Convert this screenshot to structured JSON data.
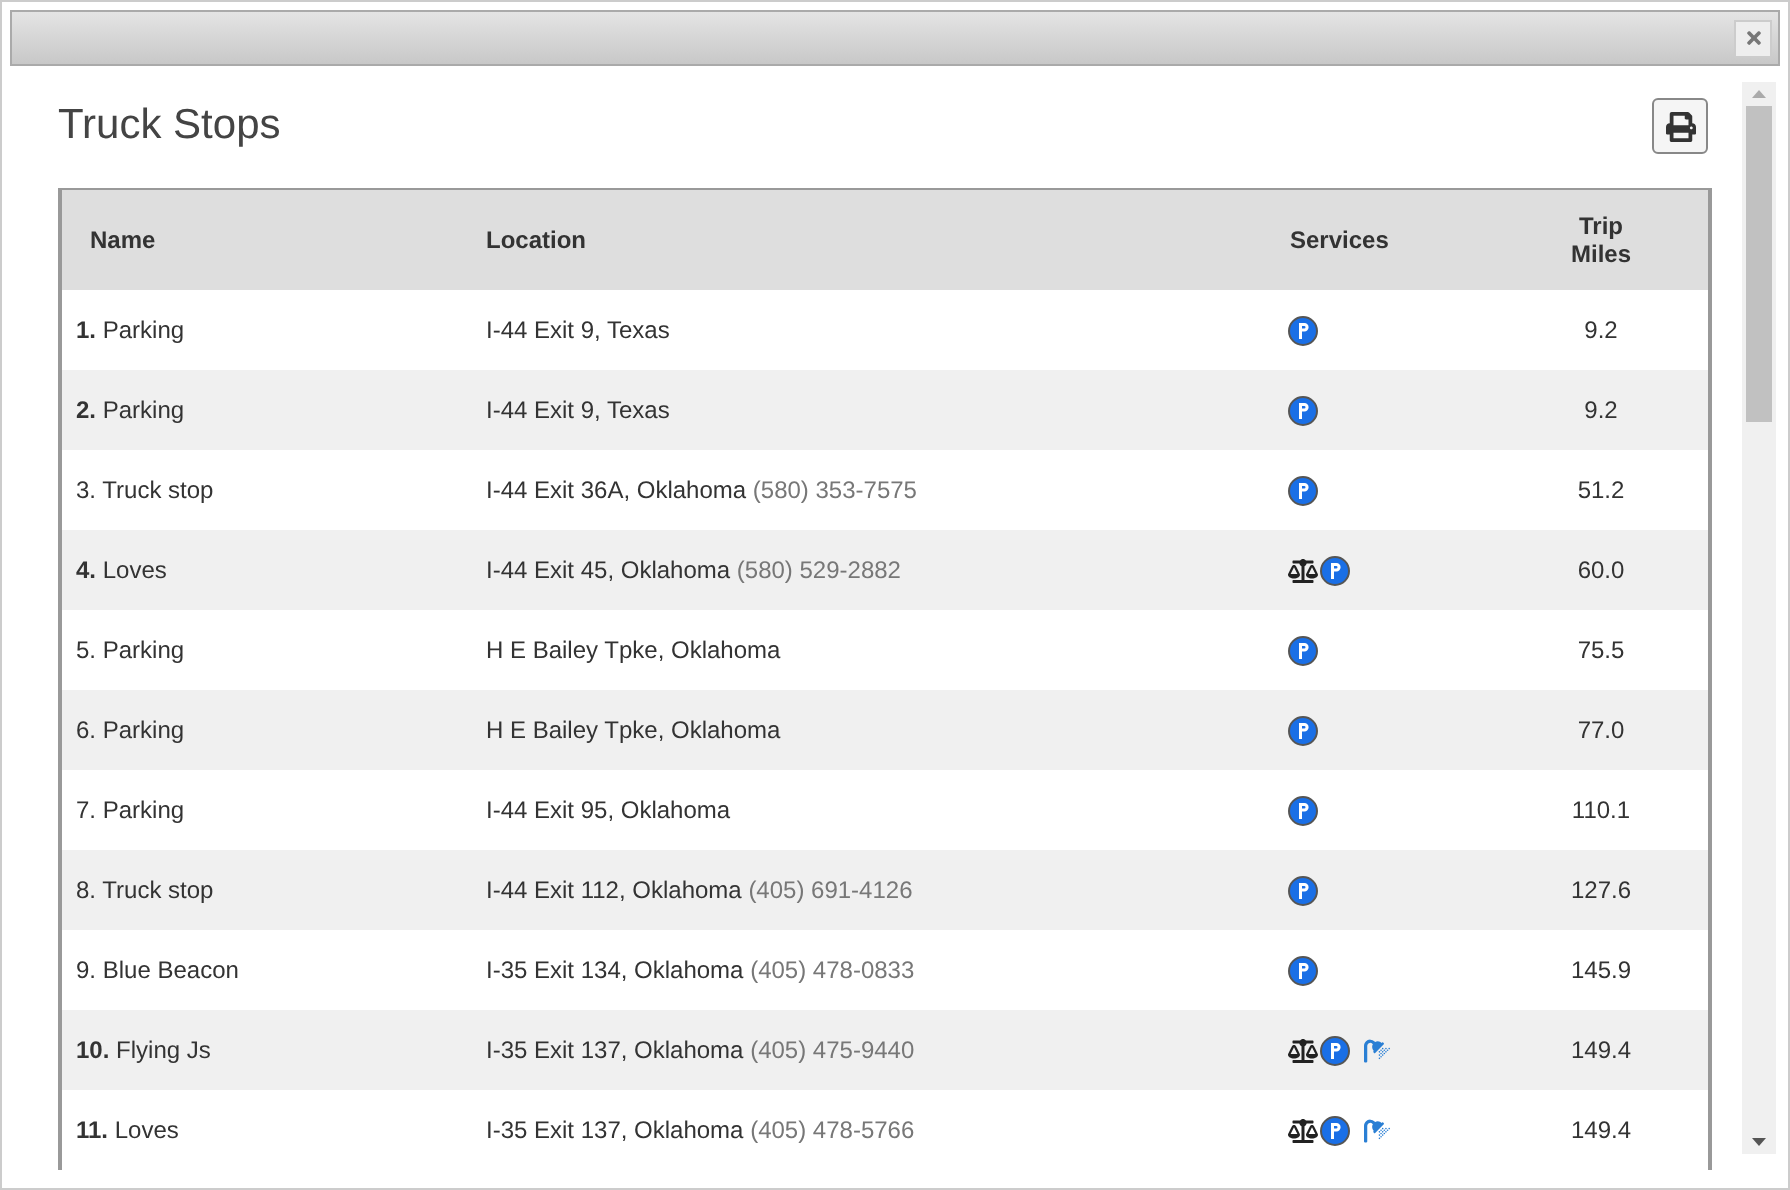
{
  "dialog": {
    "title": "Truck Stops"
  },
  "table": {
    "columns": [
      "Name",
      "Location",
      "Services",
      "Trip Miles"
    ],
    "rows": [
      {
        "number": "1.",
        "number_bold": true,
        "name": "Parking",
        "location": "I-44 Exit 9, Texas",
        "services": [
          {
            "kind": "parking"
          }
        ],
        "miles": "9.2"
      },
      {
        "number": "2.",
        "number_bold": true,
        "name": "Parking",
        "location": "I-44 Exit 9, Texas",
        "services": [
          {
            "kind": "parking"
          }
        ],
        "miles": "9.2"
      },
      {
        "number": "3.",
        "number_bold": false,
        "name": "Truck stop",
        "location": "I-44 Exit 36A, Oklahoma",
        "phone": "(580) 353-7575",
        "services": [
          {
            "kind": "parking"
          }
        ],
        "miles": "51.2"
      },
      {
        "number": "4.",
        "number_bold": true,
        "name": "Loves",
        "location": "I-44 Exit 45, Oklahoma",
        "phone": "(580) 529-2882",
        "services": [
          {
            "kind": "scale"
          },
          {
            "kind": "parking"
          }
        ],
        "miles": "60.0"
      },
      {
        "number": "5.",
        "number_bold": false,
        "name": "Parking",
        "location": "H E Bailey Tpke, Oklahoma",
        "services": [
          {
            "kind": "parking"
          }
        ],
        "miles": "75.5"
      },
      {
        "number": "6.",
        "number_bold": false,
        "name": "Parking",
        "location": "H E Bailey Tpke, Oklahoma",
        "services": [
          {
            "kind": "parking"
          }
        ],
        "miles": "77.0"
      },
      {
        "number": "7.",
        "number_bold": false,
        "name": "Parking",
        "location": "I-44 Exit 95, Oklahoma",
        "services": [
          {
            "kind": "parking"
          }
        ],
        "miles": "110.1"
      },
      {
        "number": "8.",
        "number_bold": false,
        "name": "Truck stop",
        "location": "I-44 Exit 112, Oklahoma",
        "phone": "(405) 691-4126",
        "services": [
          {
            "kind": "parking"
          }
        ],
        "miles": "127.6"
      },
      {
        "number": "9.",
        "number_bold": false,
        "name": "Blue Beacon",
        "location": "I-35 Exit 134, Oklahoma",
        "phone": "(405) 478-0833",
        "services": [
          {
            "kind": "parking"
          }
        ],
        "miles": "145.9"
      },
      {
        "number": "10.",
        "number_bold": true,
        "name": "Flying Js",
        "location": "I-35 Exit 137, Oklahoma",
        "phone": "(405) 475-9440",
        "services": [
          {
            "kind": "scale"
          },
          {
            "kind": "parking"
          },
          {
            "kind": "shower"
          }
        ],
        "miles": "149.4"
      },
      {
        "number": "11.",
        "number_bold": true,
        "name": "Loves",
        "location": "I-35 Exit 137, Oklahoma",
        "phone": "(405) 478-5766",
        "services": [
          {
            "kind": "scale"
          },
          {
            "kind": "parking"
          },
          {
            "kind": "shower"
          }
        ],
        "miles": "149.4"
      }
    ]
  }
}
